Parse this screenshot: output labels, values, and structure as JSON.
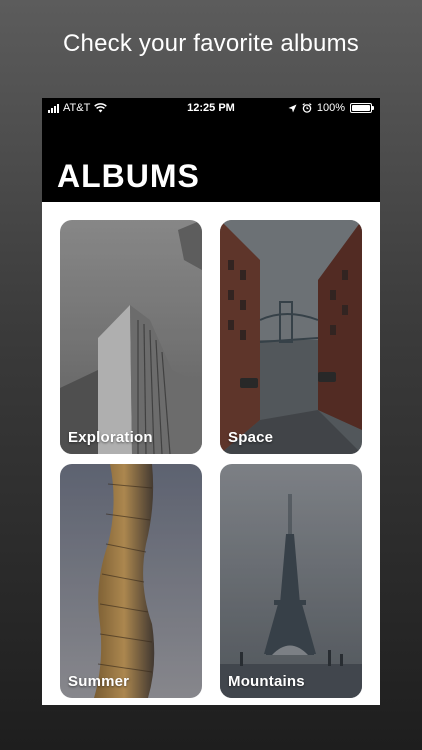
{
  "promo": {
    "headline": "Check your favorite albums"
  },
  "status_bar": {
    "carrier": "AT&T",
    "time": "12:25 PM",
    "battery": "100%",
    "icons": [
      "signal-icon",
      "wifi-icon",
      "location-icon",
      "alarm-icon",
      "battery-icon"
    ]
  },
  "header": {
    "title": "ALBUMS"
  },
  "albums": [
    {
      "label": "Exploration"
    },
    {
      "label": "Space"
    },
    {
      "label": "Summer"
    },
    {
      "label": "Mountains"
    }
  ],
  "colors": {
    "header_bg": "#000000",
    "content_bg": "#ffffff",
    "label_text": "#ffffff"
  }
}
